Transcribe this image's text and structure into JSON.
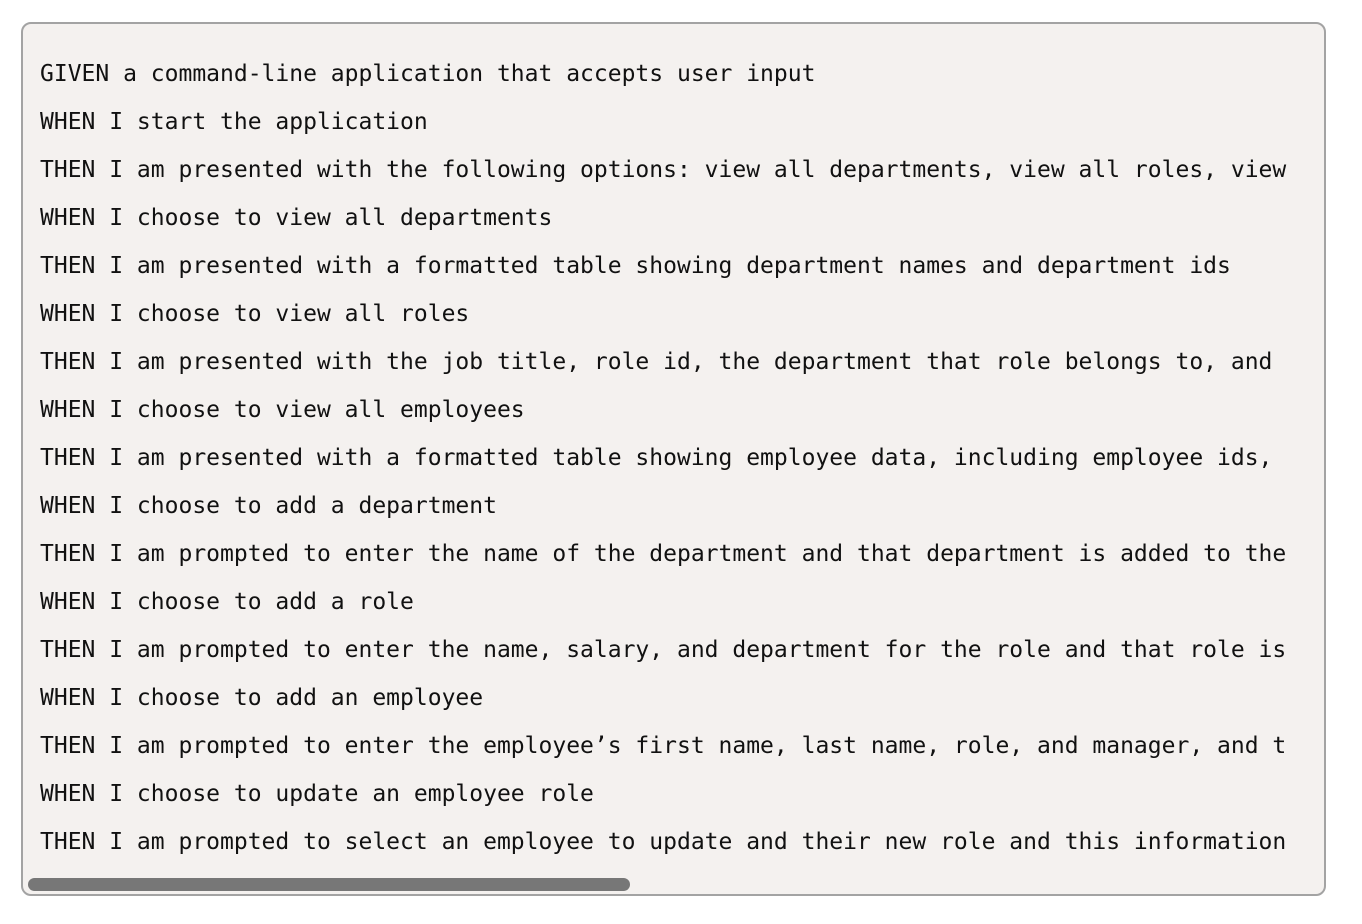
{
  "code_block": {
    "lines": [
      "GIVEN a command-line application that accepts user input",
      "WHEN I start the application",
      "THEN I am presented with the following options: view all departments, view all roles, view",
      "WHEN I choose to view all departments",
      "THEN I am presented with a formatted table showing department names and department ids",
      "WHEN I choose to view all roles",
      "THEN I am presented with the job title, role id, the department that role belongs to, and",
      "WHEN I choose to view all employees",
      "THEN I am presented with a formatted table showing employee data, including employee ids,",
      "WHEN I choose to add a department",
      "THEN I am prompted to enter the name of the department and that department is added to the",
      "WHEN I choose to add a role",
      "THEN I am prompted to enter the name, salary, and department for the role and that role is",
      "WHEN I choose to add an employee",
      "THEN I am prompted to enter the employee’s first name, last name, role, and manager, and t",
      "WHEN I choose to update an employee role",
      "THEN I am prompted to select an employee to update and their new role and this information"
    ]
  },
  "scrollbar": {
    "horizontal_scroll_position": 0,
    "visible_fraction": 0.46
  },
  "colors": {
    "panel_background": "#f4f1ef",
    "panel_border": "#a3a3a3",
    "text": "#111111",
    "scrollbar_thumb": "#777777"
  }
}
